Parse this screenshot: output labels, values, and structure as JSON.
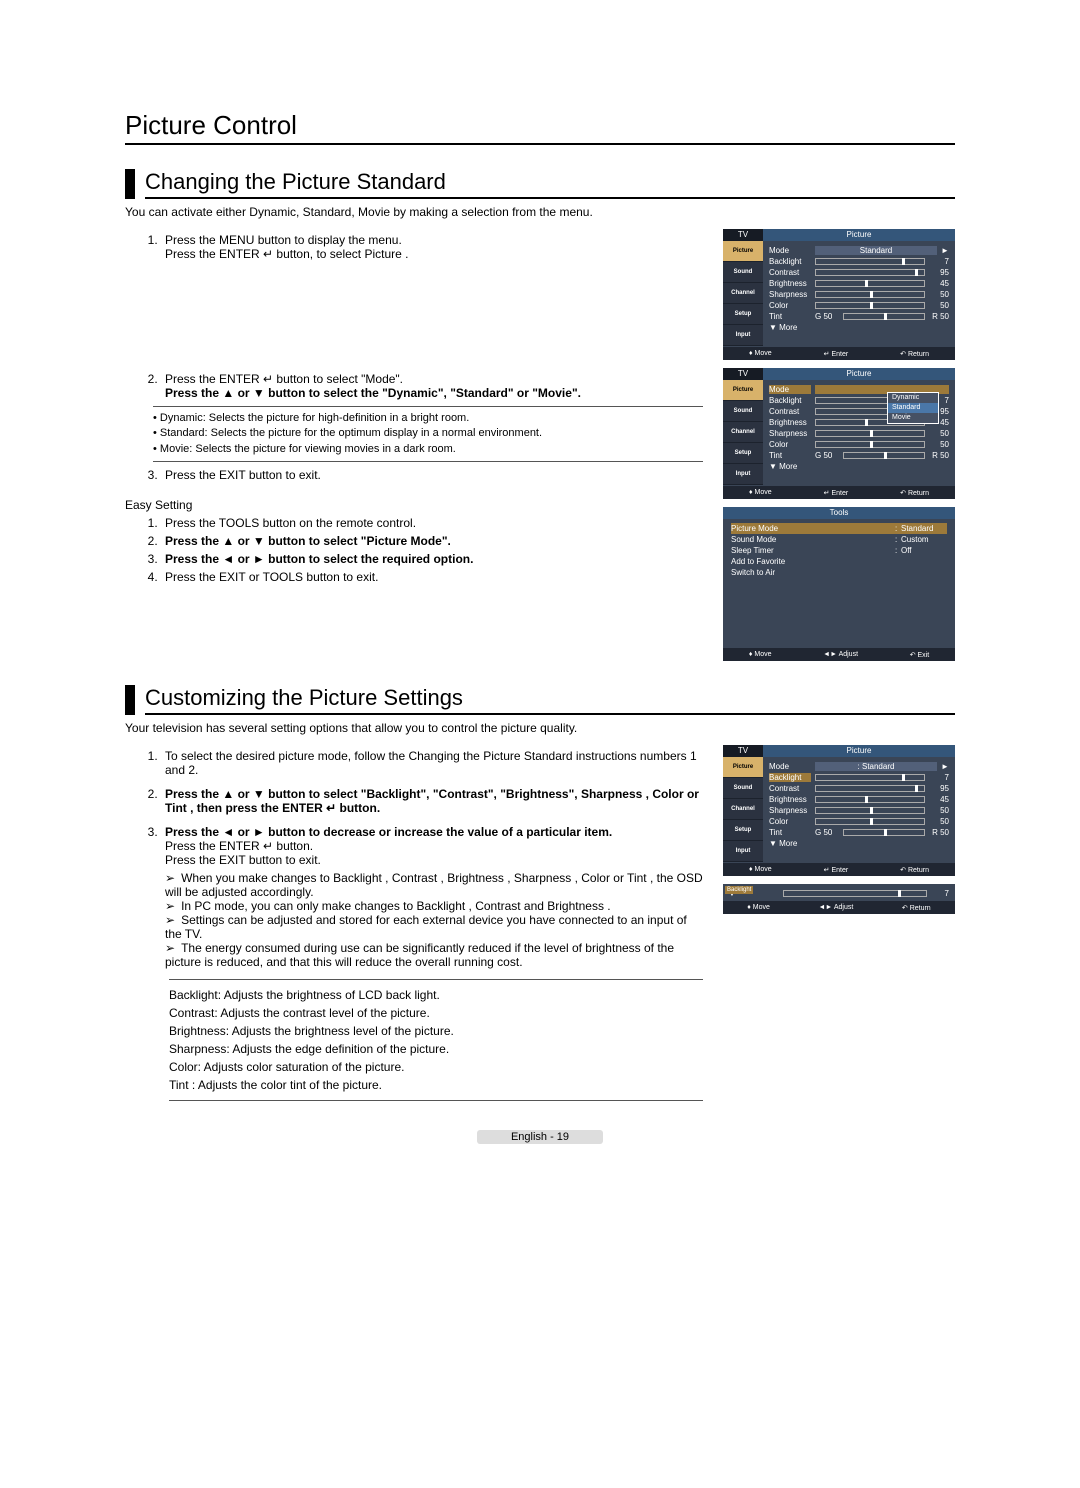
{
  "page_title": "Picture Control",
  "footer": "English - 19",
  "sections": {
    "changing": {
      "title": "Changing the Picture Standard",
      "intro": "You can activate either Dynamic, Standard, Movie by making a selection from the menu.",
      "step1a": "Press the MENU button to display the menu.",
      "step1b": "Press the ENTER ↵ button, to select  Picture .",
      "step2a": "Press the ENTER ↵ button to select \"Mode\".",
      "step2b": "Press the ▲ or ▼ button to select the \"Dynamic\", \"Standard\" or \"Movie\".",
      "mode_dynamic": "• Dynamic: Selects the picture for high-definition in a bright room.",
      "mode_standard": "• Standard: Selects the picture for the optimum display in a normal environment.",
      "mode_movie": "• Movie: Selects the picture for viewing movies in a dark room.",
      "step3": "Press the EXIT button to exit.",
      "easy_hdr": "Easy Setting",
      "easy1": "Press the TOOLS button on the remote control.",
      "easy2": "Press the ▲ or ▼ button to select \"Picture Mode\".",
      "easy3": "Press the ◄ or ► button to select the required option.",
      "easy4": "Press the EXIT or TOOLS button to exit."
    },
    "customizing": {
      "title": "Customizing the Picture Settings",
      "intro": "Your television has several setting options that allow you to control the picture quality.",
      "step1": "To select the desired picture mode, follow the  Changing the Picture Standard  instructions numbers 1 and 2.",
      "step2": "Press the ▲ or ▼ button to select \"Backlight\", \"Contrast\", \"Brightness\",  Sharpness ,  Color  or  Tint , then press the  ENTER ↵ button.",
      "step3a": "Press the ◄ or ► button to decrease or increase the value of a particular item.",
      "step3b": "Press the ENTER ↵ button.",
      "step3c": "Press the EXIT button to exit.",
      "note1": "When you make changes to  Backlight ,  Contrast ,  Brightness ,  Sharpness ,  Color  or  Tint , the OSD will be adjusted accordingly.",
      "note2": "In PC mode, you can only make changes to  Backlight ,  Contrast  and  Brightness .",
      "note3": "Settings can be adjusted and stored for each external device you have connected to an input of the TV.",
      "note4": "The energy consumed during use can be significantly reduced if the level of brightness of the picture is reduced, and that this will reduce the overall running cost.",
      "def1": "Backlight: Adjusts the brightness of LCD back light.",
      "def2": "Contrast: Adjusts the contrast level of the picture.",
      "def3": "Brightness: Adjusts the brightness level of the picture.",
      "def4": "Sharpness: Adjusts the edge definition of the picture.",
      "def5": "Color: Adjusts color saturation of the picture.",
      "def6": "Tint : Adjusts the color tint of the picture."
    }
  },
  "osd": {
    "tv": "TV",
    "title": "Picture",
    "tabs": [
      "Picture",
      "Sound",
      "Channel",
      "Setup",
      "Input"
    ],
    "mode_label": "Mode",
    "mode_value": "Standard",
    "rows": [
      {
        "label": "Backlight",
        "val": "7",
        "pos": 80
      },
      {
        "label": "Contrast",
        "val": "95",
        "pos": 92
      },
      {
        "label": "Brightness",
        "val": "45",
        "pos": 45
      },
      {
        "label": "Sharpness",
        "val": "50",
        "pos": 50
      },
      {
        "label": "Color",
        "val": "50",
        "pos": 50
      }
    ],
    "tint_label": "Tint",
    "tint_g": "G 50",
    "tint_r": "R 50",
    "more": "▼ More",
    "foot_move": "Move",
    "foot_enter": "Enter",
    "foot_return": "Return",
    "mode_options": [
      "Dynamic",
      "Standard",
      "Movie"
    ]
  },
  "tools": {
    "title": "Tools",
    "rows": [
      {
        "l": "Picture Mode",
        "v": "Standard"
      },
      {
        "l": "Sound Mode",
        "v": "Custom"
      },
      {
        "l": "Sleep Timer",
        "v": "Off"
      },
      {
        "l": "Add to Favorite",
        "v": ""
      },
      {
        "l": "Switch to Air",
        "v": ""
      }
    ],
    "foot_move": "Move",
    "foot_adjust": "Adjust",
    "foot_exit": "Exit"
  },
  "mini": {
    "label": "Backlight",
    "val": "7",
    "foot_move": "Move",
    "foot_adjust": "Adjust",
    "foot_return": "Return"
  },
  "mode_value_colon": ": Standard"
}
